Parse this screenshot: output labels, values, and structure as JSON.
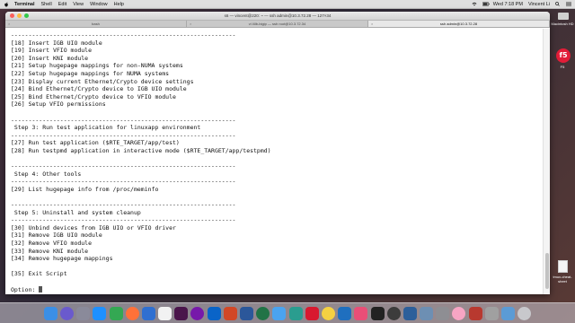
{
  "menubar": {
    "app": "Terminal",
    "items": [
      "Shell",
      "Edit",
      "View",
      "Window",
      "Help"
    ],
    "clock": "Wed 7:18 PM",
    "user": "Vincent Li"
  },
  "window": {
    "title": "s6 — vincent@220: ~ — ssh admin@10.3.72.28 — 127×34",
    "tabs": [
      {
        "label": "bash"
      },
      {
        "label": "vi l4lb-bigip — ssh root@10.3.72.34"
      },
      {
        "label": "ssh admin@10.3.72.28",
        "active": true
      }
    ]
  },
  "terminal": {
    "lines": [
      "----------------------------------------------------------------",
      "[18] Insert IGB UIO module",
      "[19] Insert VFIO module",
      "[20] Insert KNI module",
      "[21] Setup hugepage mappings for non-NUMA systems",
      "[22] Setup hugepage mappings for NUMA systems",
      "[23] Display current Ethernet/Crypto device settings",
      "[24] Bind Ethernet/Crypto device to IGB UIO module",
      "[25] Bind Ethernet/Crypto device to VFIO module",
      "[26] Setup VFIO permissions",
      "",
      "----------------------------------------------------------------",
      " Step 3: Run test application for linuxapp environment",
      "----------------------------------------------------------------",
      "[27] Run test application ($RTE_TARGET/app/test)",
      "[28] Run testpmd application in interactive mode ($RTE_TARGET/app/testpmd)",
      "",
      "----------------------------------------------------------------",
      " Step 4: Other tools",
      "----------------------------------------------------------------",
      "[29] List hugepage info from /proc/meminfo",
      "",
      "----------------------------------------------------------------",
      " Step 5: Uninstall and system cleanup",
      "----------------------------------------------------------------",
      "[30] Unbind devices from IGB UIO or VFIO driver",
      "[31] Remove IGB UIO module",
      "[32] Remove VFIO module",
      "[33] Remove KNI module",
      "[34] Remove hugepage mappings",
      "",
      "[35] Exit Script",
      "",
      "Option: "
    ]
  },
  "desktop": {
    "items": [
      {
        "label": "Macintosh HD"
      },
      {
        "label": "F5"
      },
      {
        "label": "tmux-cheat-sheet"
      }
    ]
  },
  "dock": {
    "apps": [
      {
        "name": "finder-icon",
        "color": "#3b8fe6"
      },
      {
        "name": "siri-icon",
        "color": "#6a5acd"
      },
      {
        "name": "launchpad-icon",
        "color": "#8a8a9a"
      },
      {
        "name": "safari-icon",
        "color": "#1e90ff"
      },
      {
        "name": "chrome-icon",
        "color": "#34a853"
      },
      {
        "name": "firefox-icon",
        "color": "#ff7139"
      },
      {
        "name": "thunderbird-icon",
        "color": "#2f6fd1"
      },
      {
        "name": "calendar-icon",
        "color": "#f2f2f2"
      },
      {
        "name": "slack-icon",
        "color": "#4a154b"
      },
      {
        "name": "onenote-icon",
        "color": "#7719aa"
      },
      {
        "name": "outlook-icon",
        "color": "#0a64c8"
      },
      {
        "name": "powerpoint-icon",
        "color": "#d24726"
      },
      {
        "name": "word-icon",
        "color": "#2b579a"
      },
      {
        "name": "excel-icon",
        "color": "#217346"
      },
      {
        "name": "mail-icon",
        "color": "#4aa3f0"
      },
      {
        "name": "webex-icon",
        "color": "#2a9d8f"
      },
      {
        "name": "f5-icon",
        "color": "#d8192f"
      },
      {
        "name": "notes-icon",
        "color": "#f5d142"
      },
      {
        "name": "vscode-icon",
        "color": "#1f6fbf"
      },
      {
        "name": "skitch-icon",
        "color": "#e94e77"
      },
      {
        "name": "terminal-icon",
        "color": "#222222"
      },
      {
        "name": "activity-monitor-icon",
        "color": "#3c3c3c"
      },
      {
        "name": "virtualbox-icon",
        "color": "#2d5f9a"
      },
      {
        "name": "preview-icon",
        "color": "#6d8fb3"
      },
      {
        "name": "system-preferences-icon",
        "color": "#8e8e93"
      },
      {
        "name": "photos-icon",
        "color": "#f7a5c4"
      },
      {
        "name": "hopper-icon",
        "color": "#b8392f"
      },
      {
        "name": "utility-icon",
        "color": "#a0a0a0"
      },
      {
        "name": "downloads-icon",
        "color": "#5b9bd5"
      },
      {
        "name": "trash-icon",
        "color": "#c8c8cc"
      }
    ]
  }
}
